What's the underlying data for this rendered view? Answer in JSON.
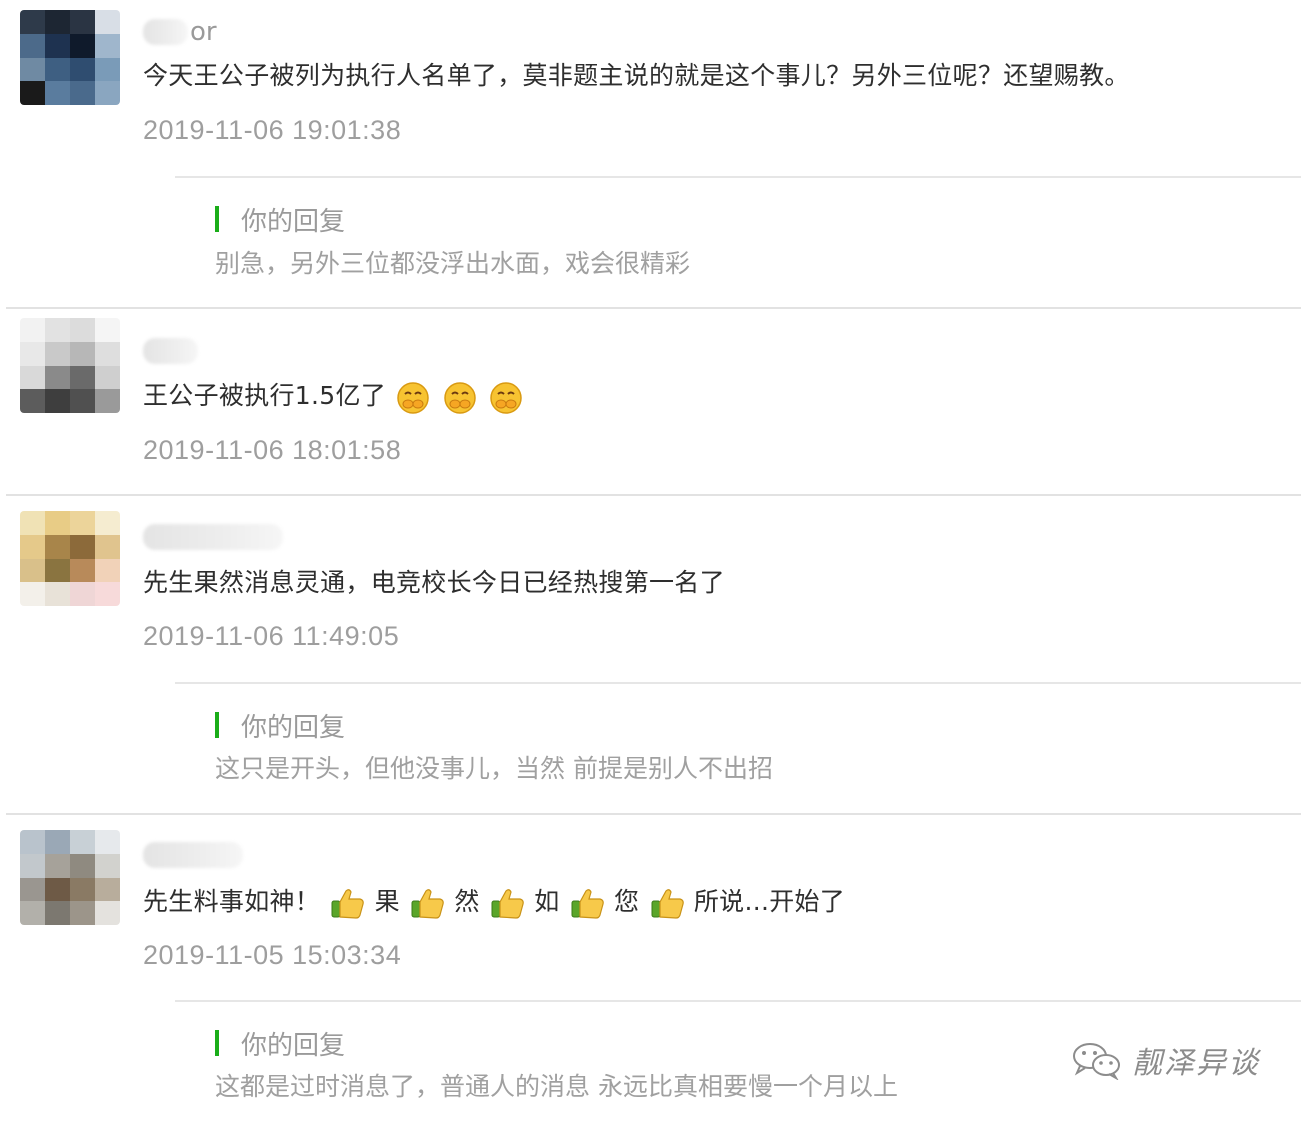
{
  "comments": [
    {
      "nick_tail": "or",
      "text": "今天王公子被列为执行人名单了，莫非题主说的就是这个事儿？另外三位呢？还望赐教。",
      "time": "2019-11-06 19:01:38",
      "reply": {
        "label": "你的回复",
        "text": "别急，另外三位都没浮出水面，戏会很精彩"
      }
    },
    {
      "nick_tail": "",
      "text": "王公子被执行1.5亿了",
      "emoji_count": 3,
      "time": "2019-11-06 18:01:58"
    },
    {
      "nick_tail": "",
      "text": "先生果然消息灵通，电竞校长今日已经热搜第一名了",
      "time": "2019-11-06 11:49:05",
      "reply": {
        "label": "你的回复",
        "text": "这只是开头，但他没事儿，当然 前提是别人不出招"
      }
    },
    {
      "nick_tail": "",
      "text_parts": [
        "先生料事如神！",
        "果",
        "然",
        "如",
        "您",
        "所说...开始了"
      ],
      "time": "2019-11-05 15:03:34",
      "reply": {
        "label": "你的回复",
        "text": "这都是过时消息了，普通人的消息 永远比真相要慢一个月以上"
      }
    }
  ],
  "watermark": {
    "text": "靓泽异谈"
  },
  "colors": {
    "reply_bar": "#1aad19",
    "time": "#9e9e9e",
    "reply_text": "#a0a0a0"
  },
  "icons": [
    "pixelated-avatar",
    "cover-mouth-emoji",
    "thumbs-up-emoji",
    "wechat-icon"
  ]
}
